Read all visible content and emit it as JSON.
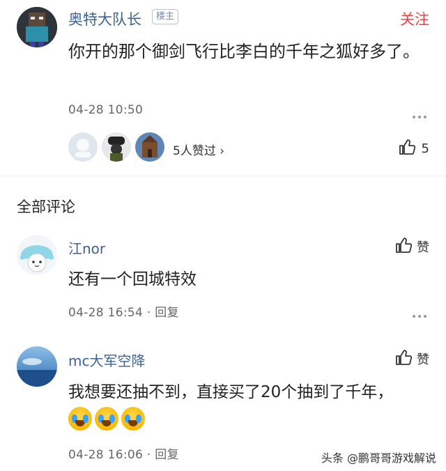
{
  "post": {
    "author": "奥特大队长",
    "badge": "楼主",
    "follow_label": "关注",
    "text": "你开的那个御剑飞行比李白的千年之狐好多了。",
    "time": "04-28 10:50",
    "likers_text": "5人赞过 ›",
    "like_count": "5"
  },
  "comments_section": {
    "title": "全部评论"
  },
  "comments": [
    {
      "author": "江nor",
      "text": "还有一个回城特效",
      "time": "04-28 16:54 · 回复",
      "like_label": "赞"
    },
    {
      "author": "mc大军空降",
      "text": "我想要还抽不到，直接买了20个抽到了千年，",
      "emoji": [
        "crying-laughing-emoji",
        "crying-laughing-emoji",
        "crying-laughing-emoji"
      ],
      "time": "04-28 16:06 · 回复",
      "like_label": "赞"
    }
  ],
  "watermark": "头条 @鹏哥哥游戏解说",
  "colors": {
    "name": "#40628f",
    "follow": "#f04142",
    "meta": "#666666"
  }
}
